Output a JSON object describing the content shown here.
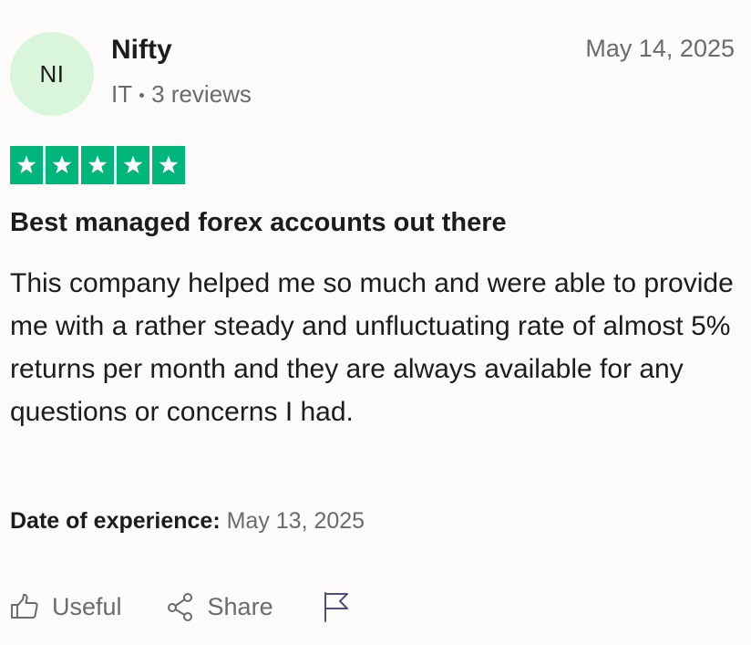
{
  "reviewer": {
    "initials": "NI",
    "name": "Nifty",
    "country": "IT",
    "reviews": "3 reviews"
  },
  "review": {
    "date": "May 14, 2025",
    "rating": 5,
    "title": "Best managed forex accounts out there",
    "body": "This company helped me so much and were able to provide me with a rather steady and unfluctuating rate of almost 5% returns per month and they are always available for any questions or concerns I had.",
    "experience_label": "Date of experience:",
    "experience_date": "May 13, 2025"
  },
  "actions": {
    "useful_label": "Useful",
    "share_label": "Share",
    "report_icon": "flag-icon"
  },
  "colors": {
    "star_green": "#00b67a",
    "avatar_bg": "#d9f6dc",
    "muted_text": "#6b6b6b"
  }
}
